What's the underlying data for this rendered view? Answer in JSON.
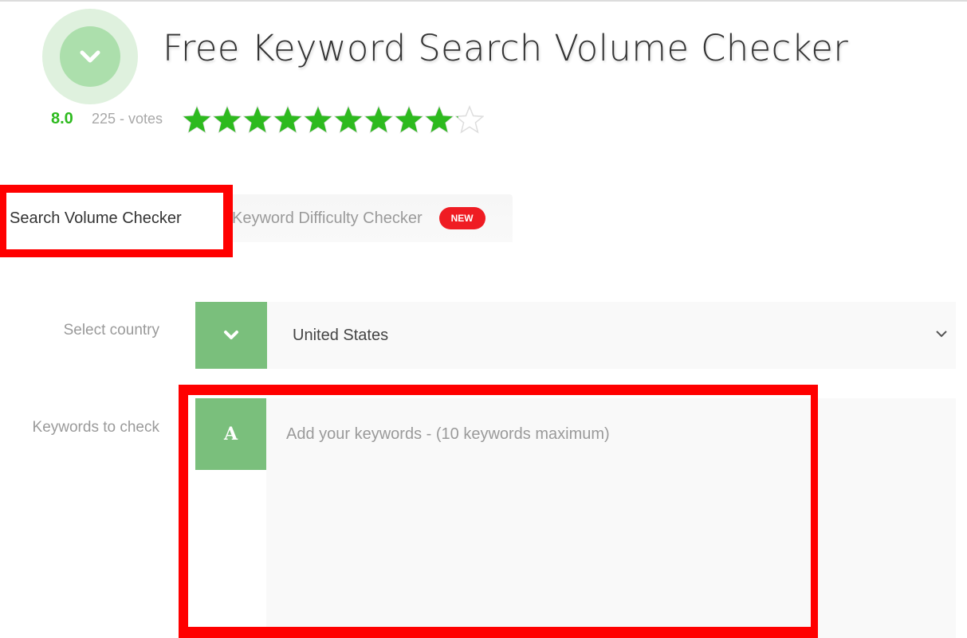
{
  "header": {
    "title": "Free Keyword Search Volume Checker",
    "logo_icon": "chevron-down-icon"
  },
  "rating": {
    "score": "8.0",
    "votes": "225 - votes",
    "max_stars": 10,
    "filled_stars": 9.1,
    "star_color": "#2dba1e",
    "empty_star_color": "#dddddd"
  },
  "tabs": [
    {
      "label": "Search Volume Checker",
      "active": true
    },
    {
      "label": "Keyword Difficulty Checker",
      "active": false,
      "badge": "NEW"
    }
  ],
  "form": {
    "country": {
      "label": "Select country",
      "icon": "chevron-down-icon",
      "selected": "United States"
    },
    "keywords": {
      "label": "Keywords to check",
      "icon_letter": "A",
      "value": "",
      "placeholder": "Add your keywords - (10 keywords maximum)"
    }
  },
  "colors": {
    "accent_green": "#7abf7c",
    "badge_red": "#ef1c23",
    "highlight_red": "#ff0000"
  }
}
